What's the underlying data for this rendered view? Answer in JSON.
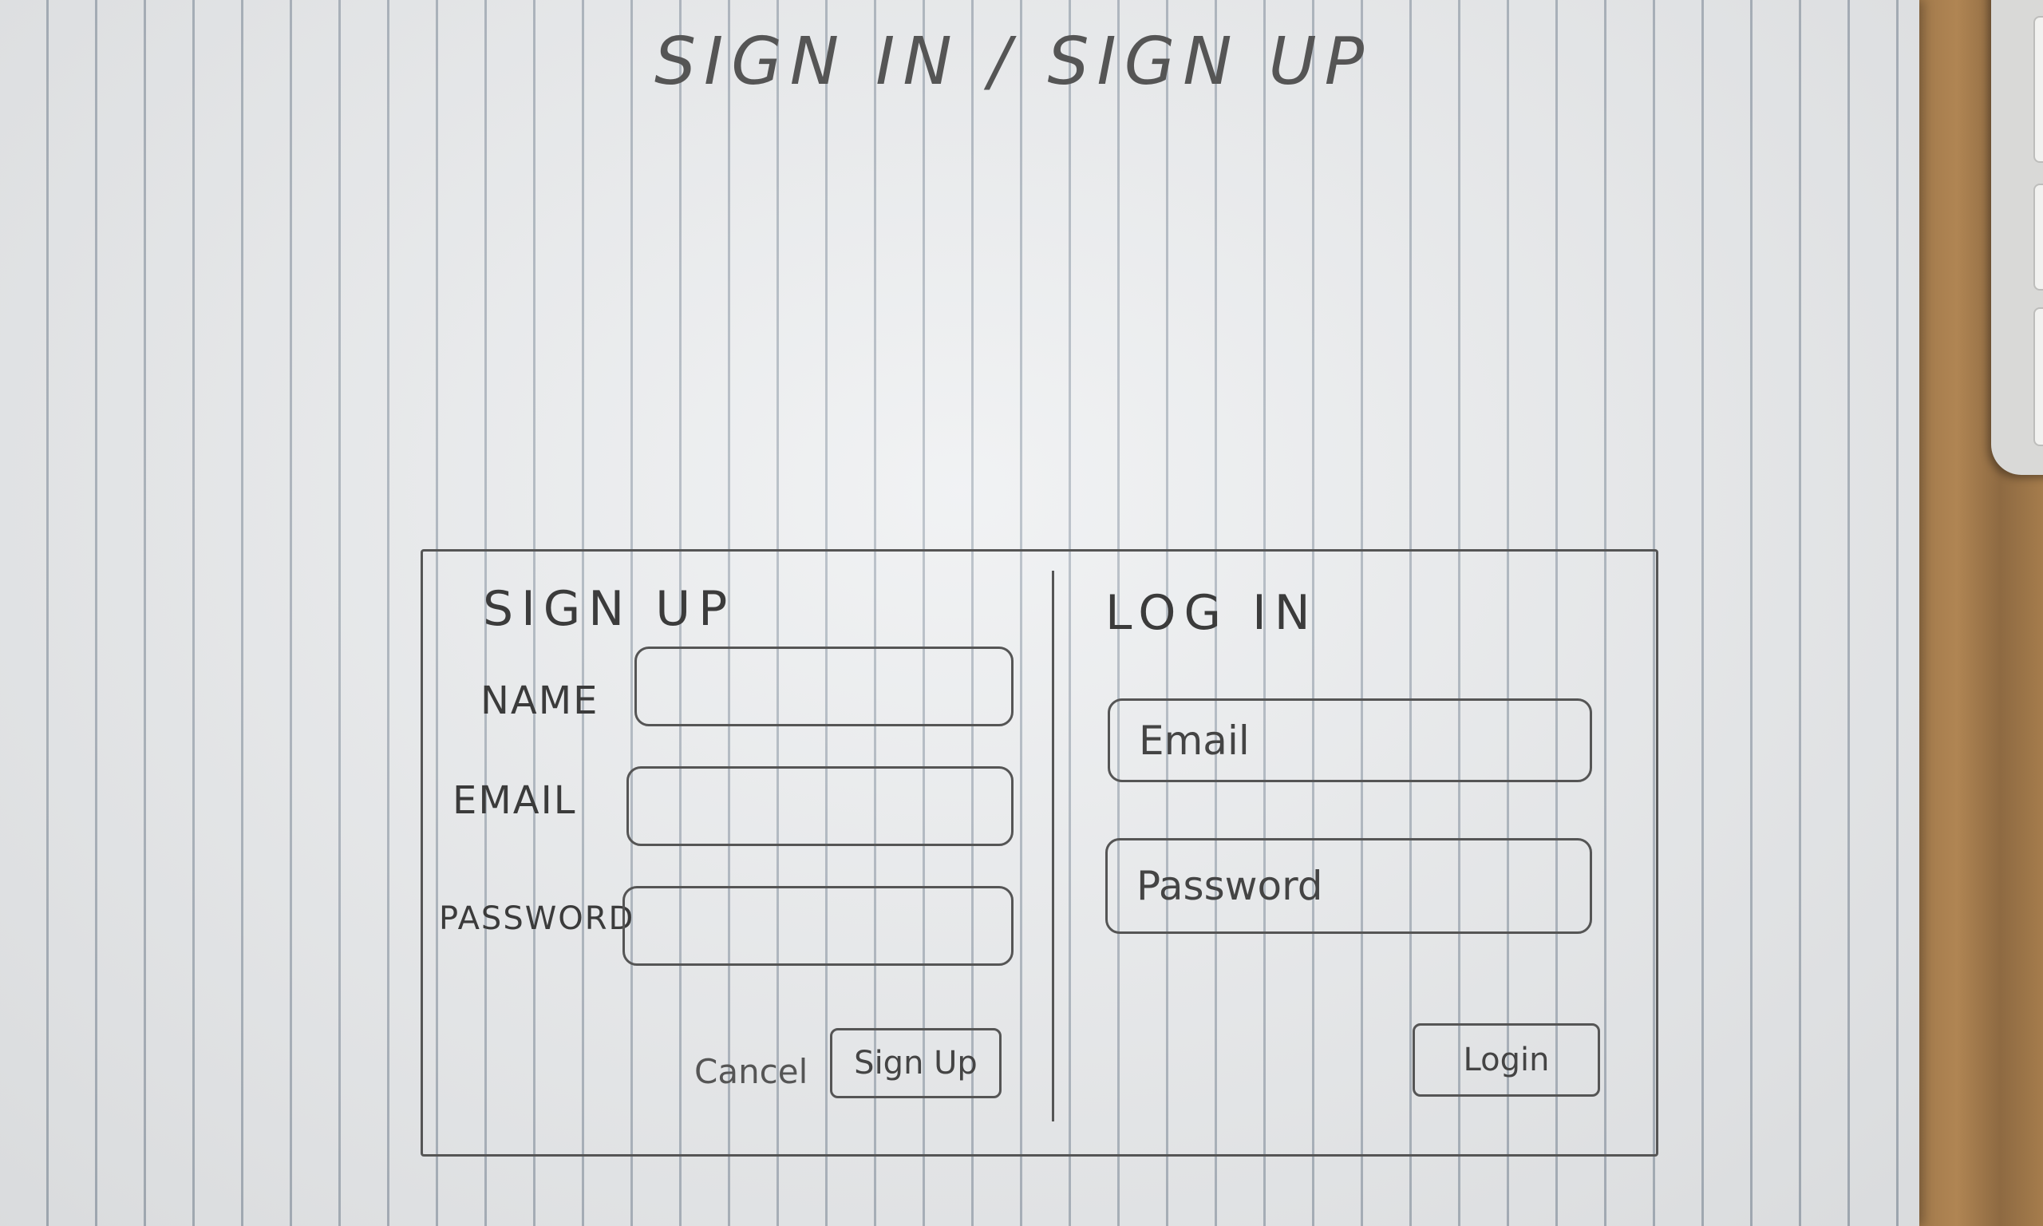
{
  "page": {
    "title": "SIGN IN / SIGN UP"
  },
  "signup": {
    "title": "SIGN UP",
    "name_label": "NAME",
    "email_label": "EMAIL",
    "password_label": "PASSWORD",
    "cancel_label": "Cancel",
    "submit_label": "Sign Up"
  },
  "login": {
    "title": "LOG IN",
    "email_placeholder": "Email",
    "password_placeholder": "Password",
    "submit_label": "Login"
  }
}
